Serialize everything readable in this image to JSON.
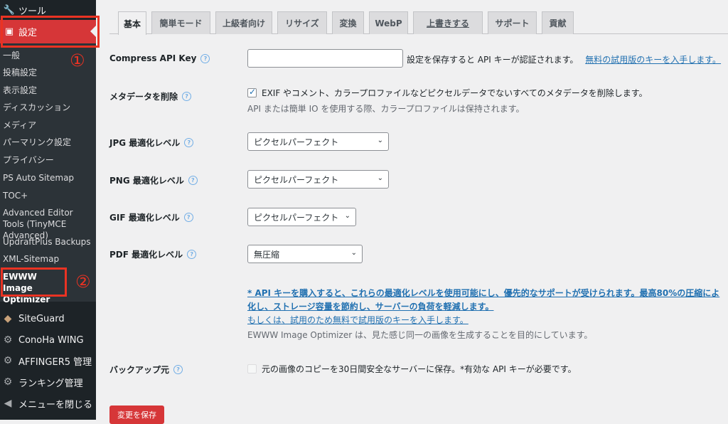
{
  "sidebar": {
    "tools_label": "ツール",
    "settings_label": "設定",
    "submenu": [
      "一般",
      "投稿設定",
      "表示設定",
      "ディスカッション",
      "メディア",
      "パーマリンク設定",
      "プライバシー",
      "PS Auto Sitemap",
      "TOC+",
      "Advanced Editor Tools (TinyMCE Advanced)",
      "UpdraftPlus Backups",
      "XML-Sitemap",
      "EWWW Image Optimizer"
    ],
    "bottom": [
      {
        "label": "SiteGuard",
        "icon": "siteguard-icon"
      },
      {
        "label": "ConoHa WING",
        "icon": "gear-icon"
      },
      {
        "label": "AFFINGER5 管理",
        "icon": "gear-icon"
      },
      {
        "label": "ランキング管理",
        "icon": "gear-icon"
      },
      {
        "label": "メニューを閉じる",
        "icon": "collapse-icon"
      }
    ]
  },
  "annotations": {
    "one": "①",
    "two": "②"
  },
  "tabs": [
    "基本",
    "簡単モード",
    "上級者向け",
    "リサイズ",
    "変換",
    "WebP",
    "上書きする",
    "サポート",
    "貢献"
  ],
  "form": {
    "api_key": {
      "label": "Compress API Key",
      "value": "",
      "note": "設定を保存すると API キーが認証されます。",
      "link": "無料の試用版のキーを入手します。"
    },
    "metadata": {
      "label": "メタデータを削除",
      "checked": true,
      "text": "EXIF やコメント、カラープロファイルなどピクセルデータでないすべてのメタデータを削除します。",
      "desc": "API または簡単 IO を使用する際、カラープロファイルは保持されます。"
    },
    "jpg": {
      "label": "JPG 最適化レベル",
      "value": "ピクセルパーフェクト"
    },
    "png": {
      "label": "PNG 最適化レベル",
      "value": "ピクセルパーフェクト"
    },
    "gif": {
      "label": "GIF 最適化レベル",
      "value": "ピクセルパーフェクト"
    },
    "pdf": {
      "label": "PDF 最適化レベル",
      "value": "無圧縮"
    },
    "promo_line1": "* API キーを購入すると、これらの最適化レベルを使用可能にし、優先的なサポートが受けられます。最高80%の圧縮によ",
    "promo_line2": "化し、ストレージ容量を節約し、サーバーの負荷を軽減します。",
    "promo_line3": "もしくは、試用のため無料で試用版のキーを入手します。",
    "promo_note": "EWWW Image Optimizer は、見た感じ同一の画像を生成することを目的にしています。",
    "backup": {
      "label": "バックアップ元",
      "checked": false,
      "text": "元の画像のコピーを30日間安全なサーバーに保存。*有効な API キーが必要です。"
    },
    "save_label": "変更を保存"
  },
  "colors": {
    "accent": "#d63638",
    "link": "#2271b1",
    "annotation": "#ea3323"
  }
}
